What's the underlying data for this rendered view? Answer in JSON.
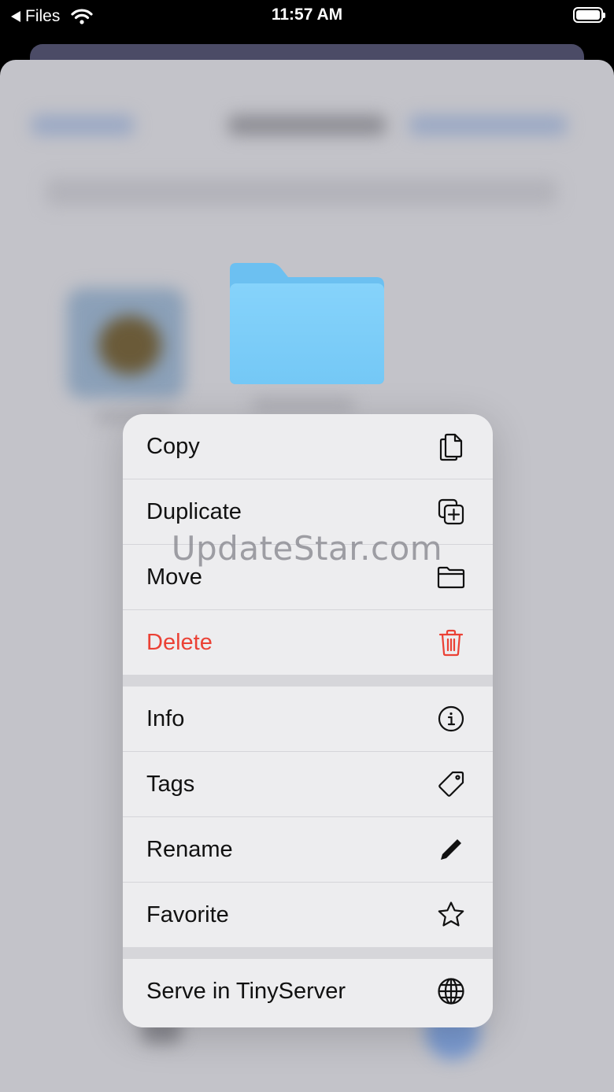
{
  "status_bar": {
    "back_label": "Files",
    "time": "11:57 AM"
  },
  "menu": {
    "groups": [
      [
        {
          "label": "Copy",
          "icon": "copy-icon"
        },
        {
          "label": "Duplicate",
          "icon": "duplicate-icon"
        },
        {
          "label": "Move",
          "icon": "folder-icon"
        },
        {
          "label": "Delete",
          "icon": "trash-icon",
          "destructive": true
        }
      ],
      [
        {
          "label": "Info",
          "icon": "info-icon"
        },
        {
          "label": "Tags",
          "icon": "tag-icon"
        },
        {
          "label": "Rename",
          "icon": "pencil-icon"
        },
        {
          "label": "Favorite",
          "icon": "star-icon"
        }
      ],
      [
        {
          "label": "Serve in TinyServer",
          "icon": "globe-icon"
        }
      ]
    ]
  },
  "watermark": "UpdateStar.com",
  "colors": {
    "destructive": "#eb4135",
    "folder": "#7ecff8",
    "menu_bg": "#ededef"
  }
}
